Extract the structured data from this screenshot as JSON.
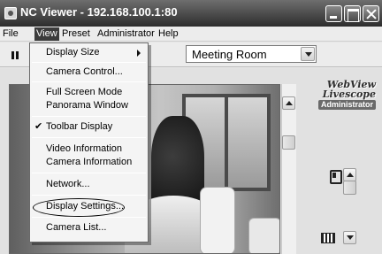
{
  "window": {
    "title": "NC Viewer - 192.168.100.1:80"
  },
  "menubar": {
    "items": [
      {
        "label": "File"
      },
      {
        "label": "View"
      },
      {
        "label": "Preset"
      },
      {
        "label": "Administrator"
      },
      {
        "label": "Help"
      }
    ]
  },
  "toolbar": {
    "preset_selected": "Meeting Room"
  },
  "brand": {
    "line1": "WebView",
    "line2": "Livescope",
    "badge": "Administrator"
  },
  "view_menu": {
    "items": [
      {
        "label": "Display Size",
        "has_submenu": true
      },
      {
        "label": "Camera Control..."
      },
      {
        "label": "Full Screen Mode"
      },
      {
        "label": "Panorama Window"
      },
      {
        "label": "Toolbar Display",
        "checked": true,
        "check": "✔"
      },
      {
        "label": "Video Information"
      },
      {
        "label": "Camera Information"
      },
      {
        "label": "Network..."
      },
      {
        "label": "Display Settings...",
        "circled": true
      },
      {
        "label": "Camera List..."
      }
    ]
  },
  "colors": {
    "titlebar": "#3a3a3a",
    "menu_active": "#3c3c3c"
  }
}
